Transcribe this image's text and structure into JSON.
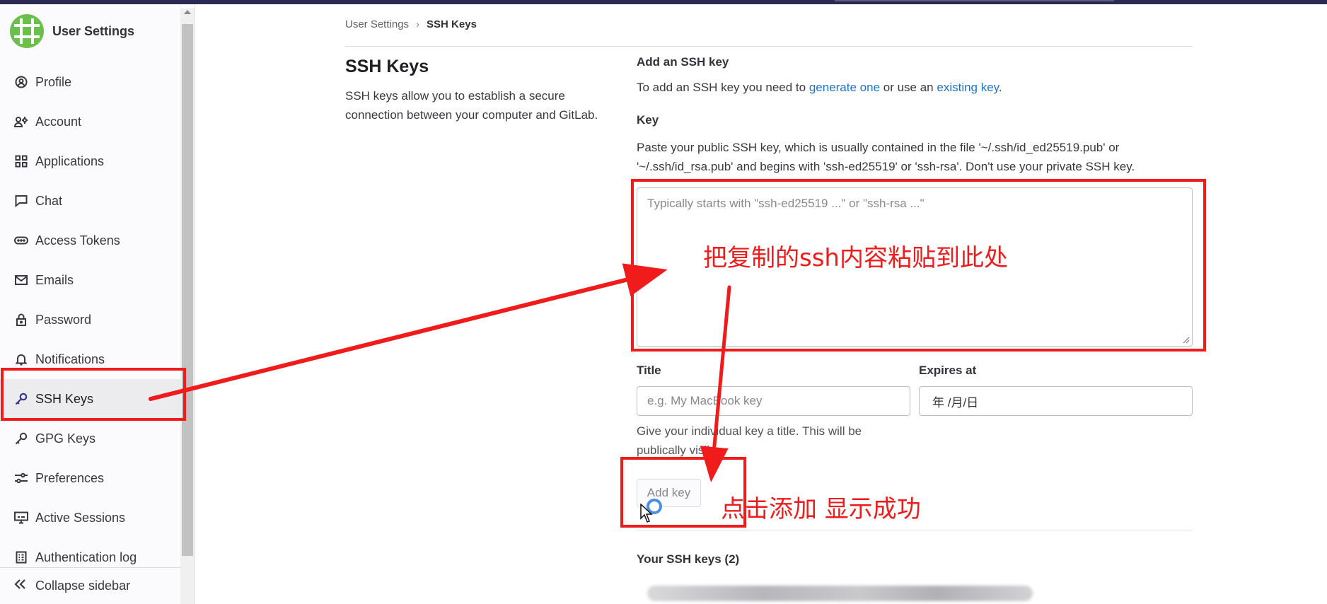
{
  "sidebar": {
    "title": "User Settings",
    "items": [
      {
        "label": "Profile",
        "icon": "profile-icon"
      },
      {
        "label": "Account",
        "icon": "account-icon"
      },
      {
        "label": "Applications",
        "icon": "applications-icon"
      },
      {
        "label": "Chat",
        "icon": "chat-icon"
      },
      {
        "label": "Access Tokens",
        "icon": "token-icon"
      },
      {
        "label": "Emails",
        "icon": "mail-icon"
      },
      {
        "label": "Password",
        "icon": "lock-icon"
      },
      {
        "label": "Notifications",
        "icon": "bell-icon"
      },
      {
        "label": "SSH Keys",
        "icon": "key-icon",
        "active": true
      },
      {
        "label": "GPG Keys",
        "icon": "key-icon"
      },
      {
        "label": "Preferences",
        "icon": "preferences-icon"
      },
      {
        "label": "Active Sessions",
        "icon": "monitor-icon"
      },
      {
        "label": "Authentication log",
        "icon": "log-icon"
      }
    ],
    "collapse_label": "Collapse sidebar"
  },
  "breadcrumb": {
    "parent": "User Settings",
    "separator": "›",
    "current": "SSH Keys"
  },
  "page": {
    "title": "SSH Keys",
    "description": "SSH keys allow you to establish a secure connection between your computer and GitLab."
  },
  "form": {
    "add_heading": "Add an SSH key",
    "add_text_before": "To add an SSH key you need to ",
    "generate_link": "generate one",
    "add_text_middle": " or use an ",
    "existing_link": "existing key",
    "add_text_after": ".",
    "key_label": "Key",
    "key_help": "Paste your public SSH key, which is usually contained in the file '~/.ssh/id_ed25519.pub' or '~/.ssh/id_rsa.pub' and begins with 'ssh-ed25519' or 'ssh-rsa'. Don't use your private SSH key.",
    "key_placeholder": "Typically starts with \"ssh-ed25519 ...\" or \"ssh-rsa ...\"",
    "title_label": "Title",
    "title_placeholder": "e.g. My MacBook key",
    "title_help": "Give your individual key a title. This will be publically visible.",
    "expires_label": "Expires at",
    "expires_value": "年 /月/日",
    "add_button": "Add key",
    "your_keys_heading": "Your SSH keys (2)"
  },
  "annotations": {
    "paste_note": "把复制的ssh内容粘贴到此处",
    "click_note": "点击添加  显示成功",
    "color": "#f01c1c"
  },
  "colors": {
    "link": "#1f75cb",
    "active_indicator": "#4446a7",
    "topbar": "#2b2a54"
  }
}
